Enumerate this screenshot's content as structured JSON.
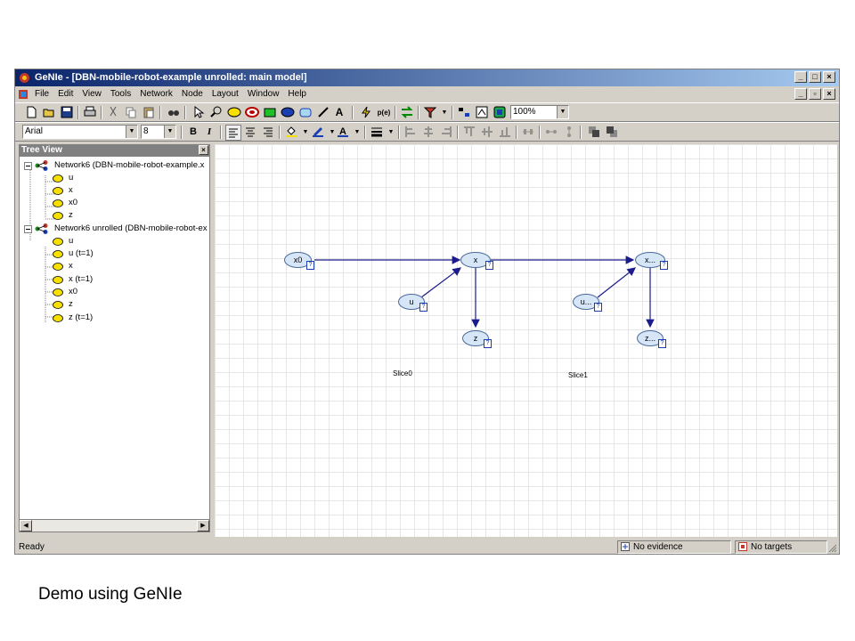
{
  "window": {
    "title": "GeNIe - [DBN-mobile-robot-example unrolled: main model]",
    "caption_buttons": [
      "_",
      "□",
      "×"
    ],
    "mdi_buttons": [
      "_",
      "▫",
      "×"
    ]
  },
  "menu": [
    "File",
    "Edit",
    "View",
    "Tools",
    "Network",
    "Node",
    "Layout",
    "Window",
    "Help"
  ],
  "toolbar": {
    "zoom": "100%",
    "font_name": "Arial",
    "font_size": "8",
    "bold_label": "B",
    "italic_label": "I",
    "text_tool_label": "A"
  },
  "tree": {
    "title": "Tree View",
    "close": "×",
    "network1": "Network6 (DBN-mobile-robot-example.x",
    "network1_nodes": [
      "u",
      "x",
      "x0",
      "z"
    ],
    "network2": "Network6 unrolled (DBN-mobile-robot-ex",
    "network2_nodes": [
      "u",
      "u (t=1)",
      "x",
      "x (t=1)",
      "x0",
      "z",
      "z (t=1)"
    ]
  },
  "graph": {
    "nodes": {
      "x0": "x0",
      "x": "x",
      "u": "u",
      "z": "z",
      "x1": "x...",
      "u1": "u...",
      "z1": "z..."
    },
    "status_mark": "?",
    "slice0": "Slice0",
    "slice1": "Slice1"
  },
  "status": {
    "ready": "Ready",
    "evidence": "No evidence",
    "targets": "No targets"
  },
  "caption": "Demo using GeNIe",
  "colors": {
    "title_start": "#0a246a",
    "title_end": "#a6caf0",
    "node_fill": "#d7e6f7",
    "node_border": "#4a6b9c",
    "arc": "#1b1b8c"
  }
}
